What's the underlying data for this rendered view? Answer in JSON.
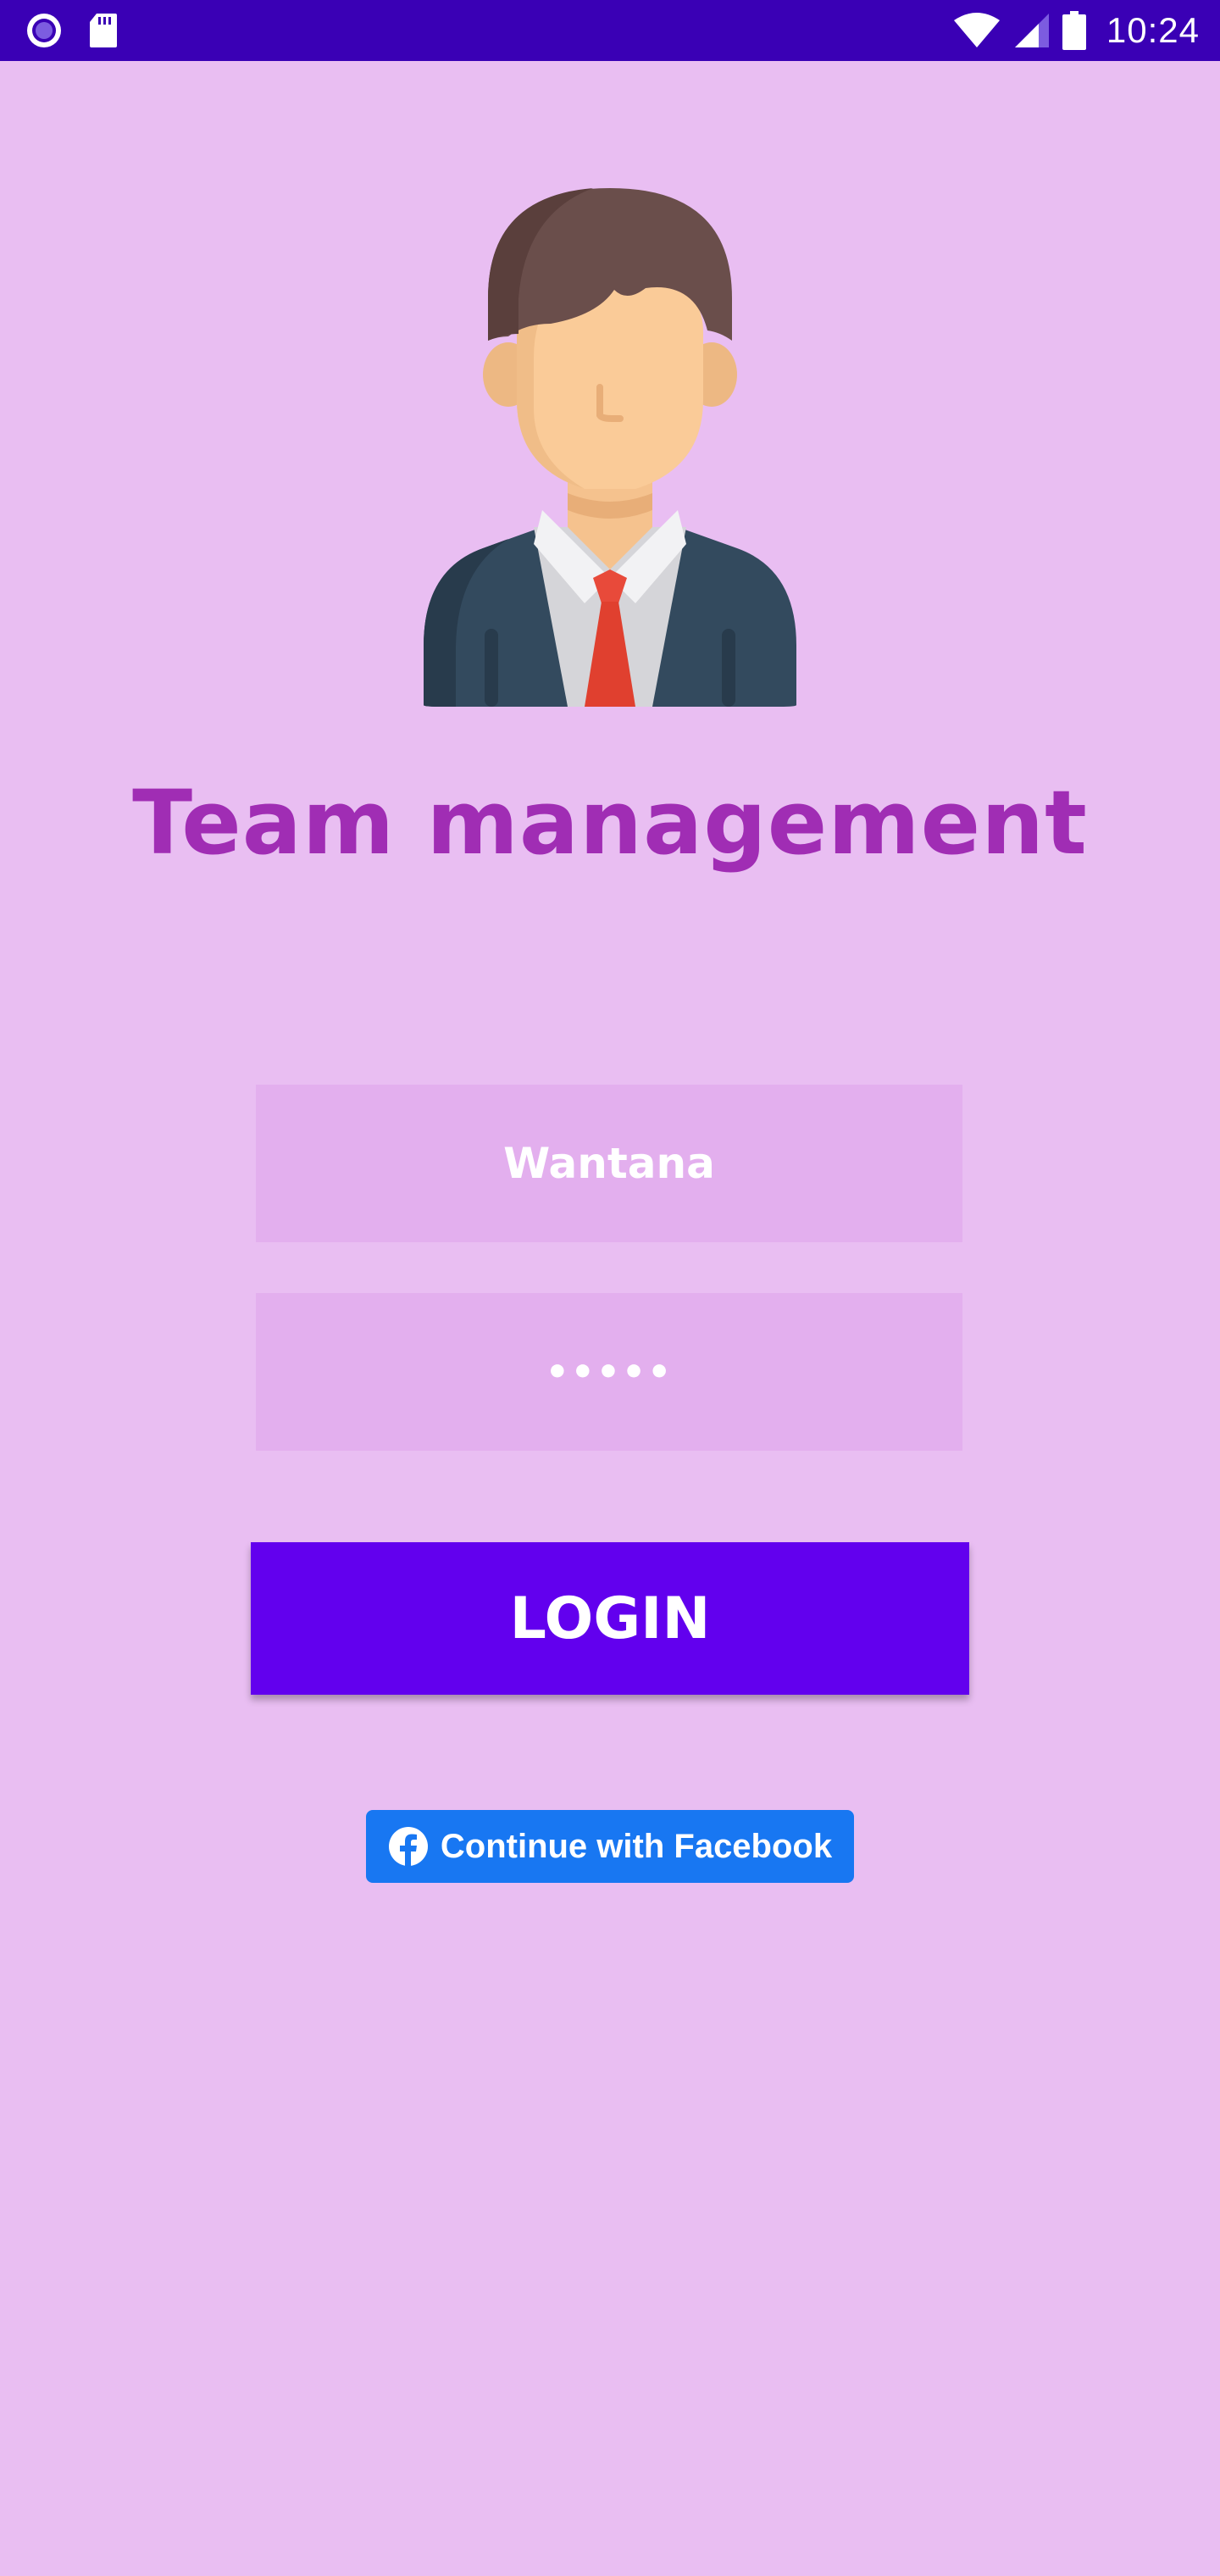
{
  "status_bar": {
    "time": "10:24",
    "left_icons": [
      "record-icon",
      "sd-card-icon"
    ],
    "right_icons": [
      "wifi-icon",
      "cellular-signal-icon",
      "battery-icon"
    ],
    "background": "#3A00B5"
  },
  "app": {
    "title": "Team management",
    "background": "#E9BEF2",
    "title_color": "#A02DB4"
  },
  "login_form": {
    "username_value": "Wantana",
    "password_value": "•••••",
    "login_label": "LOGIN",
    "login_color": "#6200EE",
    "facebook_label": "Continue with Facebook",
    "facebook_color": "#1877F2"
  }
}
